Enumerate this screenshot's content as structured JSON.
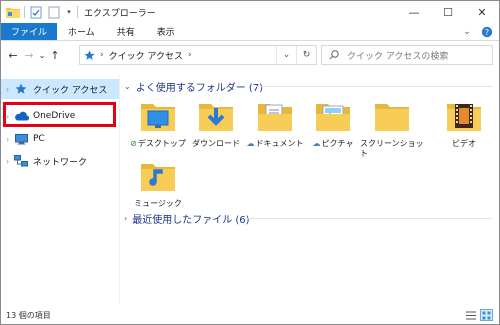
{
  "window": {
    "title": "エクスプローラー",
    "controls": {
      "minimize": "—",
      "maximize": "☐",
      "close": "✕"
    }
  },
  "ribbon": {
    "tabs": [
      {
        "label": "ファイル",
        "active": true
      },
      {
        "label": "ホーム"
      },
      {
        "label": "共有"
      },
      {
        "label": "表示"
      }
    ],
    "expand_icon": "chevron-down-icon",
    "help_icon": "help-icon"
  },
  "address": {
    "path_label": "クイック アクセス",
    "search_placeholder": "クイック アクセスの検索"
  },
  "nav": {
    "items": [
      {
        "label": "クイック アクセス",
        "icon": "star-icon",
        "selected": true
      },
      {
        "label": "OneDrive",
        "icon": "cloud-icon",
        "highlighted": true
      },
      {
        "label": "PC",
        "icon": "pc-icon"
      },
      {
        "label": "ネットワーク",
        "icon": "network-icon"
      }
    ]
  },
  "content": {
    "frequent_header": "よく使用するフォルダー (7)",
    "recent_header": "最近使用したファイル (6)",
    "folders": [
      {
        "label": "デスクトップ",
        "badge": "check"
      },
      {
        "label": "ダウンロード",
        "badge": ""
      },
      {
        "label": "ドキュメント",
        "badge": "cloud"
      },
      {
        "label": "ピクチャ",
        "badge": "cloud"
      },
      {
        "label": "スクリーンショット",
        "badge": ""
      },
      {
        "label": "ビデオ",
        "badge": ""
      },
      {
        "label": "ミュージック",
        "badge": ""
      }
    ]
  },
  "status": {
    "item_count": "13 個の項目"
  },
  "colors": {
    "accent": "#1979ca",
    "selection": "#cce8ff",
    "highlight_border": "#e60012",
    "group_header": "#1e3287"
  }
}
